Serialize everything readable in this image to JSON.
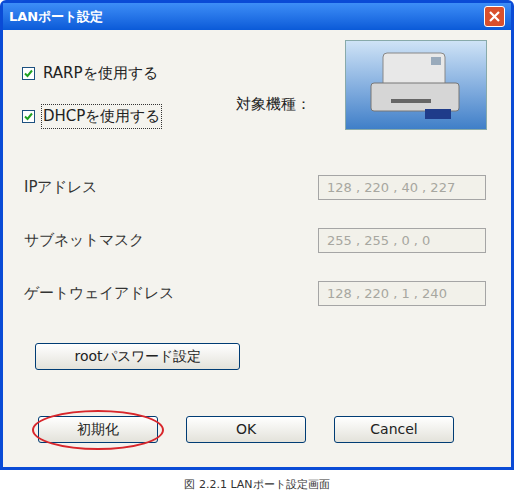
{
  "window": {
    "title": "LANポート設定"
  },
  "checkboxes": [
    {
      "label": "RARPを使用する",
      "checked": true,
      "focused": false
    },
    {
      "label": "DHCPを使用する",
      "checked": true,
      "focused": true
    }
  ],
  "target_model": {
    "label": "対象機種："
  },
  "fields": [
    {
      "label": "IPアドレス",
      "value": "128 , 220 , 40 , 227",
      "disabled": true
    },
    {
      "label": "サブネットマスク",
      "value": "255 , 255 , 0 , 0",
      "disabled": true
    },
    {
      "label": "ゲートウェイアドレス",
      "value": "128 , 220 , 1 , 240",
      "disabled": true
    }
  ],
  "root_password_button": {
    "label": "rootパスワード設定"
  },
  "buttons": [
    {
      "label": "初期化",
      "highlighted": true
    },
    {
      "label": "OK",
      "highlighted": false
    },
    {
      "label": "Cancel",
      "highlighted": false
    }
  ],
  "caption": "図 2.2.1 LANポート設定画面"
}
